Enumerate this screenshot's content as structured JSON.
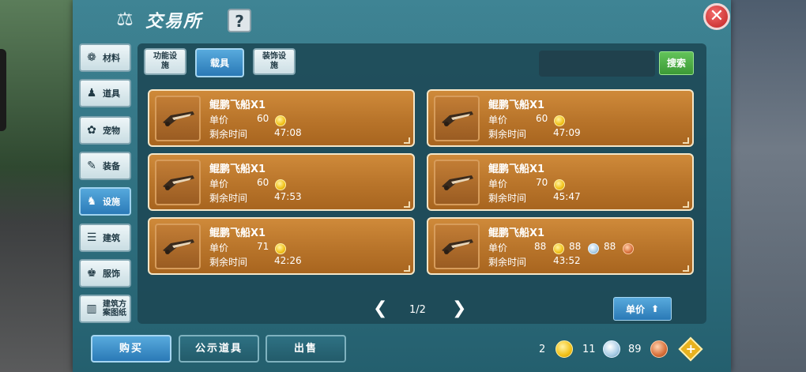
{
  "window": {
    "title": "交易所",
    "help": "?",
    "close": "✕"
  },
  "categories": [
    {
      "label": "材料",
      "icon": "material-icon",
      "glyph": "❁",
      "active": false
    },
    {
      "label": "道具",
      "icon": "item-icon",
      "glyph": "♟",
      "active": false
    },
    {
      "label": "宠物",
      "icon": "paw-icon",
      "glyph": "✿",
      "active": false
    },
    {
      "label": "装备",
      "icon": "armor-icon",
      "glyph": "✎",
      "active": false
    },
    {
      "label": "设施",
      "icon": "facility-icon",
      "glyph": "♞",
      "active": true
    },
    {
      "label": "建筑",
      "icon": "building-icon",
      "glyph": "☰",
      "active": false
    },
    {
      "label": "服饰",
      "icon": "clothing-icon",
      "glyph": "♚",
      "active": false
    },
    {
      "label": "建筑方案图纸",
      "line1": "建筑方",
      "line2": "案图纸",
      "icon": "blueprint-icon",
      "glyph": "▥",
      "active": false
    }
  ],
  "tabs": [
    {
      "line1": "功能设",
      "line2": "施",
      "active": false
    },
    {
      "line1": "载具",
      "line2": "",
      "active": true
    },
    {
      "line1": "装饰设",
      "line2": "施",
      "active": false
    }
  ],
  "search": {
    "placeholder": "",
    "button": "搜索"
  },
  "listing_labels": {
    "price": "单价",
    "time": "剩余时间"
  },
  "listings": [
    {
      "name": "鲲鹏飞船X1",
      "price_gold": "60",
      "time": "47:08"
    },
    {
      "name": "鲲鹏飞船X1",
      "price_gold": "60",
      "time": "47:09"
    },
    {
      "name": "鲲鹏飞船X1",
      "price_gold": "60",
      "time": "47:53"
    },
    {
      "name": "鲲鹏飞船X1",
      "price_gold": "70",
      "time": "45:47"
    },
    {
      "name": "鲲鹏飞船X1",
      "price_gold": "71",
      "time": "42:26"
    },
    {
      "name": "鲲鹏飞船X1",
      "price_gold": "88",
      "price_silver": "88",
      "price_copper": "88",
      "time": "43:52"
    }
  ],
  "pager": {
    "text": "1/2",
    "prev": "❮",
    "next": "❯"
  },
  "sort": {
    "label": "单价",
    "arrow": "⬆"
  },
  "bottom": {
    "buy": "购买",
    "public": "公示道具",
    "sell": "出售"
  },
  "currency": {
    "gold": "2",
    "silver": "11",
    "copper": "89",
    "add": "+"
  },
  "colors": {
    "accent": "#2a79b6",
    "card": "#b8742a",
    "search_green": "#3c9a36"
  }
}
